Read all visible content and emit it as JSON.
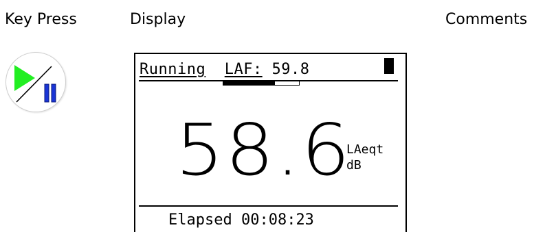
{
  "headers": {
    "key_press": "Key Press",
    "display": "Display",
    "comments": "Comments"
  },
  "key": {
    "icon": "play-pause-icon",
    "colors": {
      "play": "#22ee22",
      "pause": "#1a35d6"
    }
  },
  "display": {
    "status": "Running",
    "measure_label": "LAF:",
    "measure_value": "59.8",
    "level_fraction": 0.68,
    "main_value": "58.6",
    "unit_line1": "LAeqt",
    "unit_line2": "dB",
    "elapsed_label": "Elapsed",
    "elapsed_time": "00:08:23"
  }
}
